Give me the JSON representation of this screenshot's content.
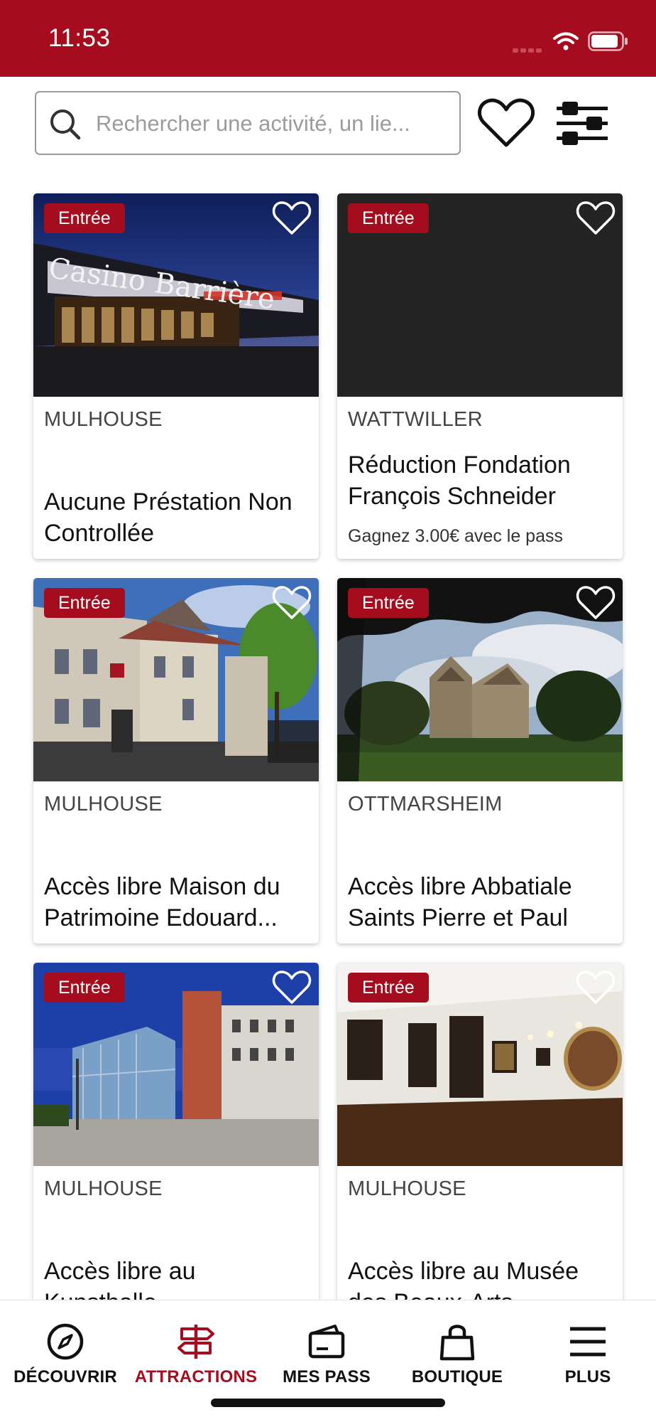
{
  "status_bar": {
    "time": "11:53",
    "background": "#a50c1d"
  },
  "search": {
    "placeholder": "Rechercher une activité, un lie..."
  },
  "cards": [
    {
      "badge": "Entrée",
      "city": "MULHOUSE",
      "title": "Aucune Préstation Non Controllée",
      "subtitle": ""
    },
    {
      "badge": "Entrée",
      "city": "WATTWILLER",
      "title": "Réduction Fondation François Schneider",
      "subtitle": "Gagnez 3.00€ avec le pass"
    },
    {
      "badge": "Entrée",
      "city": "MULHOUSE",
      "title": "Accès libre Maison du Patrimoine Edouard...",
      "subtitle": ""
    },
    {
      "badge": "Entrée",
      "city": "OTTMARSHEIM",
      "title": "Accès libre Abbatiale Saints Pierre et Paul",
      "subtitle": ""
    },
    {
      "badge": "Entrée",
      "city": "MULHOUSE",
      "title": "Accès libre au Kunsthalle",
      "subtitle": ""
    },
    {
      "badge": "Entrée",
      "city": "MULHOUSE",
      "title": "Accès libre au Musée des Beaux-Arts",
      "subtitle": ""
    }
  ],
  "image_text": {
    "casino_sign": "Casino Barrière"
  },
  "tabbar": {
    "tabs": [
      {
        "label": "DÉCOUVRIR",
        "icon": "compass-icon"
      },
      {
        "label": "ATTRACTIONS",
        "icon": "signpost-icon",
        "active": true
      },
      {
        "label": "MES PASS",
        "icon": "wallet-icon"
      },
      {
        "label": "BOUTIQUE",
        "icon": "shopping-bag-icon"
      },
      {
        "label": "PLUS",
        "icon": "menu-icon"
      }
    ]
  },
  "colors": {
    "brand": "#a50c1d",
    "text": "#111111",
    "muted": "#9c9c9c"
  }
}
